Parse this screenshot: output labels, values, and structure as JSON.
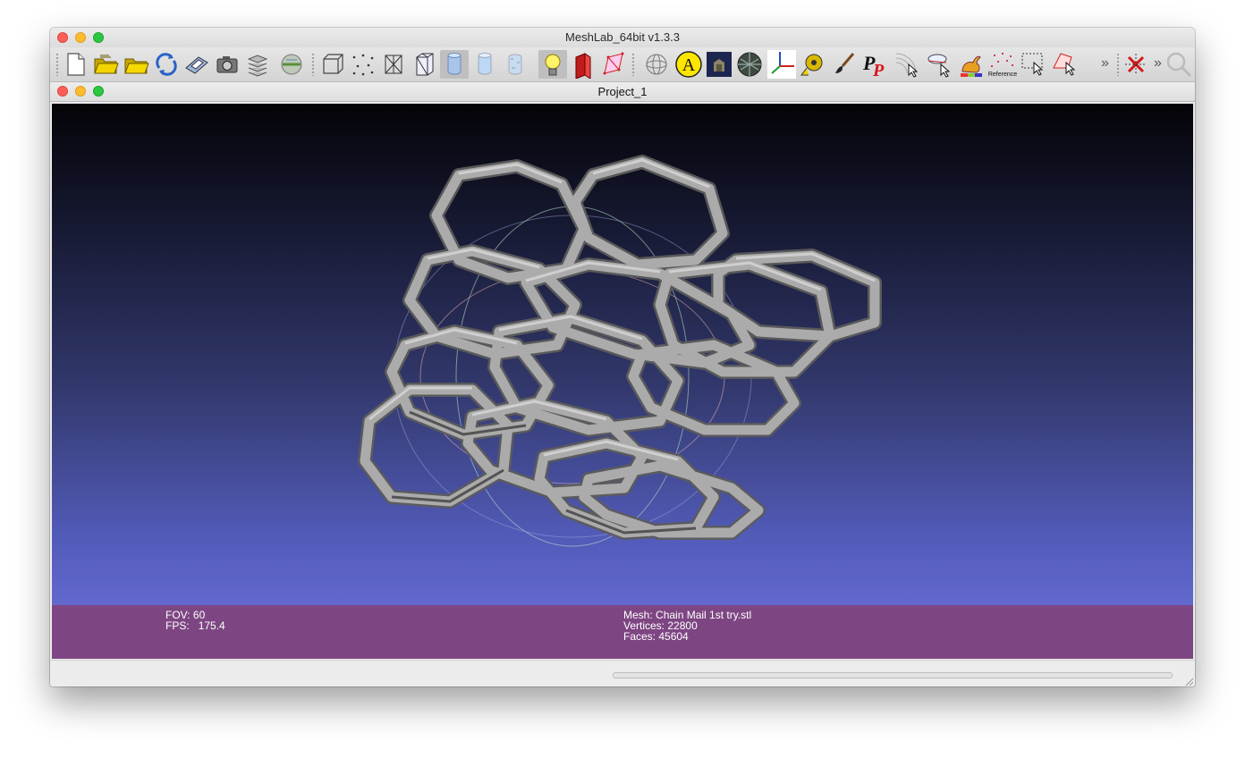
{
  "window": {
    "title": "MeshLab_64bit v1.3.3"
  },
  "document": {
    "title": "Project_1"
  },
  "toolbar": {
    "buttons": [
      {
        "name": "new-project-icon"
      },
      {
        "name": "open-project-icon"
      },
      {
        "name": "import-mesh-icon"
      },
      {
        "name": "reload-icon"
      },
      {
        "name": "save-icon"
      },
      {
        "name": "snapshot-icon"
      },
      {
        "name": "layers-icon"
      },
      {
        "name": "raster-icon"
      },
      {
        "name": "bounding-box-icon"
      },
      {
        "name": "points-icon"
      },
      {
        "name": "wireframe-icon"
      },
      {
        "name": "hidden-lines-icon"
      },
      {
        "name": "flat-lines-icon",
        "active": true
      },
      {
        "name": "flat-icon"
      },
      {
        "name": "smooth-icon"
      },
      {
        "name": "light-on-off-icon",
        "active": true
      },
      {
        "name": "backface-icon"
      },
      {
        "name": "selected-faces-icon"
      },
      {
        "name": "trackball-icon"
      },
      {
        "name": "decorate-label-icon",
        "text": "A"
      },
      {
        "name": "shader-icon"
      },
      {
        "name": "texture-icon"
      },
      {
        "name": "axes-icon"
      },
      {
        "name": "tape-measure-icon"
      },
      {
        "name": "paint-brush-icon"
      },
      {
        "name": "point-picker-icon",
        "text": "PP"
      },
      {
        "name": "pick-points-icon"
      },
      {
        "name": "align-icon"
      },
      {
        "name": "bunny-color-icon"
      },
      {
        "name": "reference-icon",
        "label": "Reference"
      },
      {
        "name": "select-faces-rect-icon"
      },
      {
        "name": "select-vertices-icon"
      },
      {
        "name": "delete-selection-icon"
      },
      {
        "name": "magnifier-icon"
      }
    ],
    "overflow_glyph": "»"
  },
  "viewport": {
    "fov_label": "FOV:",
    "fov_value": "60",
    "fps_label": "FPS:",
    "fps_value": "175.4",
    "mesh_label": "Mesh:",
    "mesh_name": "Chain Mail 1st try.stl",
    "vertices_label": "Vertices:",
    "vertices_value": "22800",
    "faces_label": "Faces:",
    "faces_value": "45604"
  },
  "colors": {
    "infobar": "#7d4682",
    "mesh": "#a8a8a8",
    "accent_yellow": "#ffe600"
  }
}
